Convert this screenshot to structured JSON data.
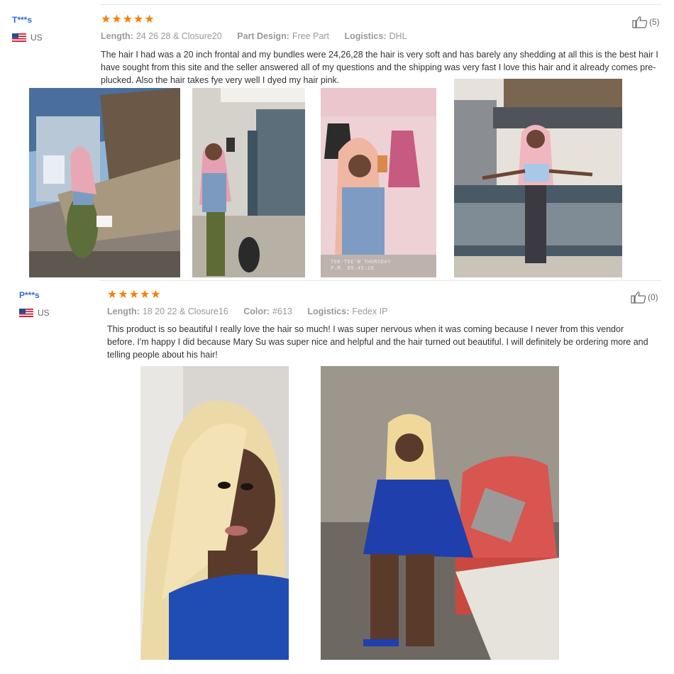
{
  "reviews": [
    {
      "user": "T***s",
      "country": "US",
      "rating": 5,
      "helpful_count": "(5)",
      "meta": [
        {
          "label": "Length:",
          "value": "24 26 28 & Closure20"
        },
        {
          "label": "Part Design:",
          "value": "Free Part"
        },
        {
          "label": "Logistics:",
          "value": "DHL"
        }
      ],
      "text": "The hair I had was a 20 inch frontal and my bundles were 24,26,28 the hair is very soft and has barely any shedding at all this is the best hair I have sought from this site and the seller answered all of my questions and the shipping was very fast I love this hair and it already comes pre-plucked. Also the hair takes fye very well I dyed my hair pink.",
      "photos": [
        {
          "name": "review-photo-outdoor-steps"
        },
        {
          "name": "review-photo-restroom-selfie"
        },
        {
          "name": "review-photo-mirror-selfie",
          "stamp_line1": "TEE-TEE'N THURSDAY",
          "stamp_line2": "P.M. 05:45:26"
        },
        {
          "name": "review-photo-balcony"
        }
      ]
    },
    {
      "user": "P***s",
      "country": "US",
      "rating": 5,
      "helpful_count": "(0)",
      "meta": [
        {
          "label": "Length:",
          "value": "18 20 22 & Closure16"
        },
        {
          "label": "Color:",
          "value": "#613"
        },
        {
          "label": "Logistics:",
          "value": "Fedex IP"
        }
      ],
      "text": "This product is so beautiful I really love the hair so much! I was super nervous when it was coming because I never from this vendor before. I'm happy I did because Mary Su was super nice and helpful and the hair turned out beautiful. I will definitely be ordering more and telling people about his hair!",
      "photos": [
        {
          "name": "review-photo-blonde-closeup"
        },
        {
          "name": "review-photo-blonde-sofa"
        }
      ]
    }
  ],
  "colors": {
    "accent_star": "#f77f07",
    "username": "#2e6dd9",
    "meta_text": "#999999",
    "body_text": "#333333"
  },
  "icons": [
    "us-flag-icon",
    "star-icon",
    "thumbs-up-icon"
  ]
}
